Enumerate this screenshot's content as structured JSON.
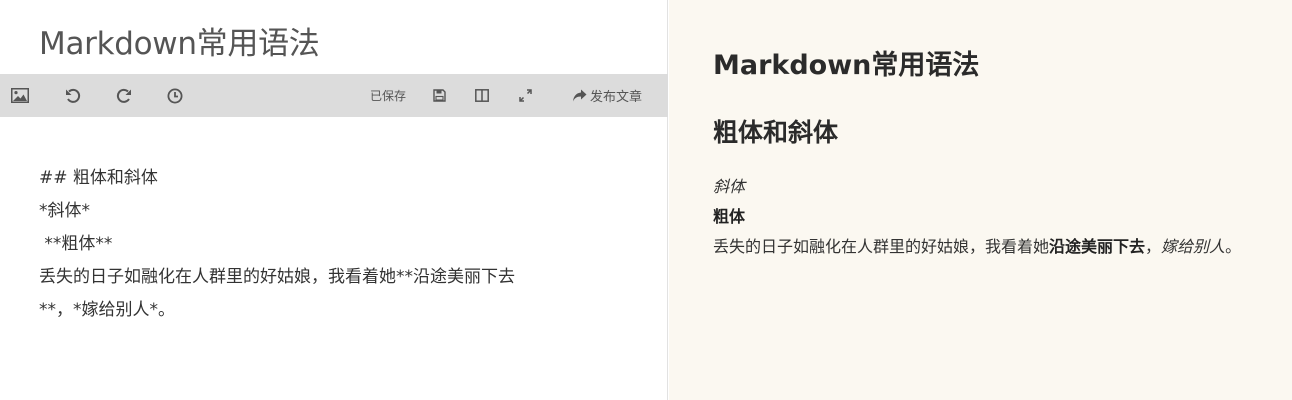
{
  "editor": {
    "title": "Markdown常用语法",
    "toolbar": {
      "image_icon": "image-icon",
      "undo_icon": "undo-icon",
      "redo_icon": "redo-icon",
      "history_icon": "clock-icon",
      "saved_label": "已保存",
      "save_icon": "save-icon",
      "split_icon": "columns-icon",
      "fullscreen_icon": "expand-icon",
      "publish_icon": "share-icon",
      "publish_label": "发布文章"
    },
    "source_lines": [
      "## 粗体和斜体",
      "*斜体*",
      " **粗体**",
      "丢失的日子如融化在人群里的好姑娘，我看着她**沿途美丽下去",
      "**，*嫁给别人*。"
    ]
  },
  "preview": {
    "h1": "Markdown常用语法",
    "h2": "粗体和斜体",
    "italic_line": "斜体",
    "bold_line": "粗体",
    "paragraph_plain": "丢失的日子如融化在人群里的好姑娘，我看着她",
    "paragraph_bold": "沿途美丽下去",
    "paragraph_sep": "，",
    "paragraph_italic": "嫁给别人",
    "paragraph_end": "。"
  },
  "colors": {
    "toolbar_bg": "#dcdcdc",
    "preview_bg": "#fbf8f1"
  }
}
